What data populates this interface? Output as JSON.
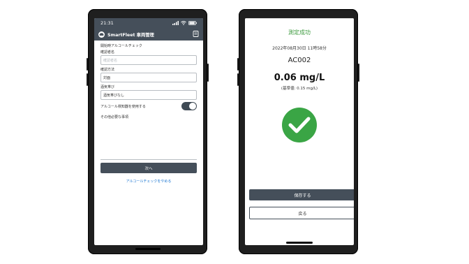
{
  "left_phone": {
    "status": {
      "time": "21:31"
    },
    "app_title": "SmartFleet 車両管理",
    "form": {
      "section_title": "開始時アルコールチェック",
      "checker_label": "確認者名",
      "checker_placeholder": "確認者名",
      "method_label": "確認方法",
      "method_value": "対面",
      "breath_label": "酒気帯び",
      "breath_value": "酒気帯びなし",
      "use_detector_label": "アルコール検知器を使用する",
      "use_detector_on": true,
      "notes_label": "その他必要な事項",
      "next_button": "次へ",
      "cancel_link": "アルコールチェックをやめる"
    }
  },
  "right_phone": {
    "success_text": "測定成功",
    "datetime": "2022年08月30日 11時58分",
    "device_code": "AC002",
    "value": "0.06 mg/L",
    "reference": "(基準値: 0.15 mg/L)",
    "save_button": "保存する",
    "back_button": "戻る"
  },
  "colors": {
    "header": "#454f5a",
    "success_green": "#3aa545",
    "link_blue": "#1b76d1"
  }
}
